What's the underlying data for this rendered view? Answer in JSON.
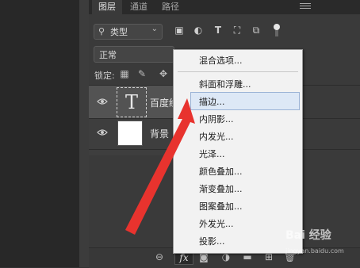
{
  "tabs": [
    {
      "label": "图层",
      "active": true
    },
    {
      "label": "通道",
      "active": false
    },
    {
      "label": "路径",
      "active": false
    }
  ],
  "filter": {
    "kind_label": "类型"
  },
  "blend_mode": "正常",
  "lock": {
    "label": "锁定:"
  },
  "layers": [
    {
      "name": "百度经验",
      "kind": "text",
      "thumb_glyph": "T",
      "selected": true
    },
    {
      "name": "背景",
      "kind": "background",
      "selected": false
    }
  ],
  "fx_menu": {
    "items": [
      "混合选项...",
      "斜面和浮雕...",
      "描边...",
      "内阴影...",
      "内发光...",
      "光泽...",
      "颜色叠加...",
      "渐变叠加...",
      "图案叠加...",
      "外发光...",
      "投影..."
    ],
    "highlighted": "描边..."
  },
  "bottom_bar": {
    "fx_label": "fx"
  },
  "watermark": {
    "text": "Bai 经验",
    "sub": "jingyan.baidu.com"
  },
  "colors": {
    "panel": "#3a3a3a",
    "menu": "#f2f2f2",
    "highlight": "#dde8f6",
    "arrow": "#e8332e"
  }
}
